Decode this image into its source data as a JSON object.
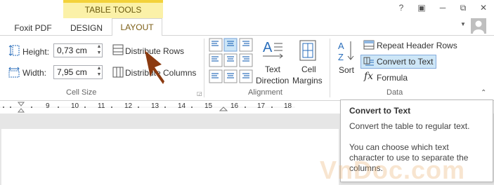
{
  "header": {
    "table_tools": "TABLE TOOLS",
    "window_controls": [
      "?",
      "▣",
      "─",
      "⧉",
      "✕"
    ]
  },
  "tabs": [
    {
      "label": "Foxit PDF"
    },
    {
      "label": "DESIGN"
    },
    {
      "label": "LAYOUT",
      "active": true
    }
  ],
  "ribbon": {
    "cell_size": {
      "label": "Cell Size",
      "height_label": "Height:",
      "height_value": "0,73 cm",
      "width_label": "Width:",
      "width_value": "7,95 cm",
      "distribute_rows": "Distribute Rows",
      "distribute_columns": "Distribute Columns"
    },
    "alignment": {
      "label": "Alignment",
      "text_direction_line1": "Text",
      "text_direction_line2": "Direction",
      "cell_margins_line1": "Cell",
      "cell_margins_line2": "Margins"
    },
    "data": {
      "label": "Data",
      "sort": "Sort",
      "repeat_header_rows": "Repeat Header Rows",
      "convert_to_text": "Convert to Text",
      "formula": "Formula",
      "formula_icon": "fx"
    }
  },
  "ruler": {
    "numbers": [
      "9",
      "10",
      "11",
      "12",
      "13",
      "14",
      "15",
      "16",
      "17",
      "18"
    ]
  },
  "tooltip": {
    "title": "Convert to Text",
    "line1": "Convert the table to regular text.",
    "line2": "You can choose which text",
    "line3": "character to use to separate the",
    "line4": "columns."
  },
  "watermark": "VnDoc.com",
  "colors": {
    "accent_table_tools": "#f3d23a",
    "layout_tab_text": "#7b5d14",
    "hover_blue": "#cde6f7",
    "cursor_arrow": "#8b3a10"
  }
}
